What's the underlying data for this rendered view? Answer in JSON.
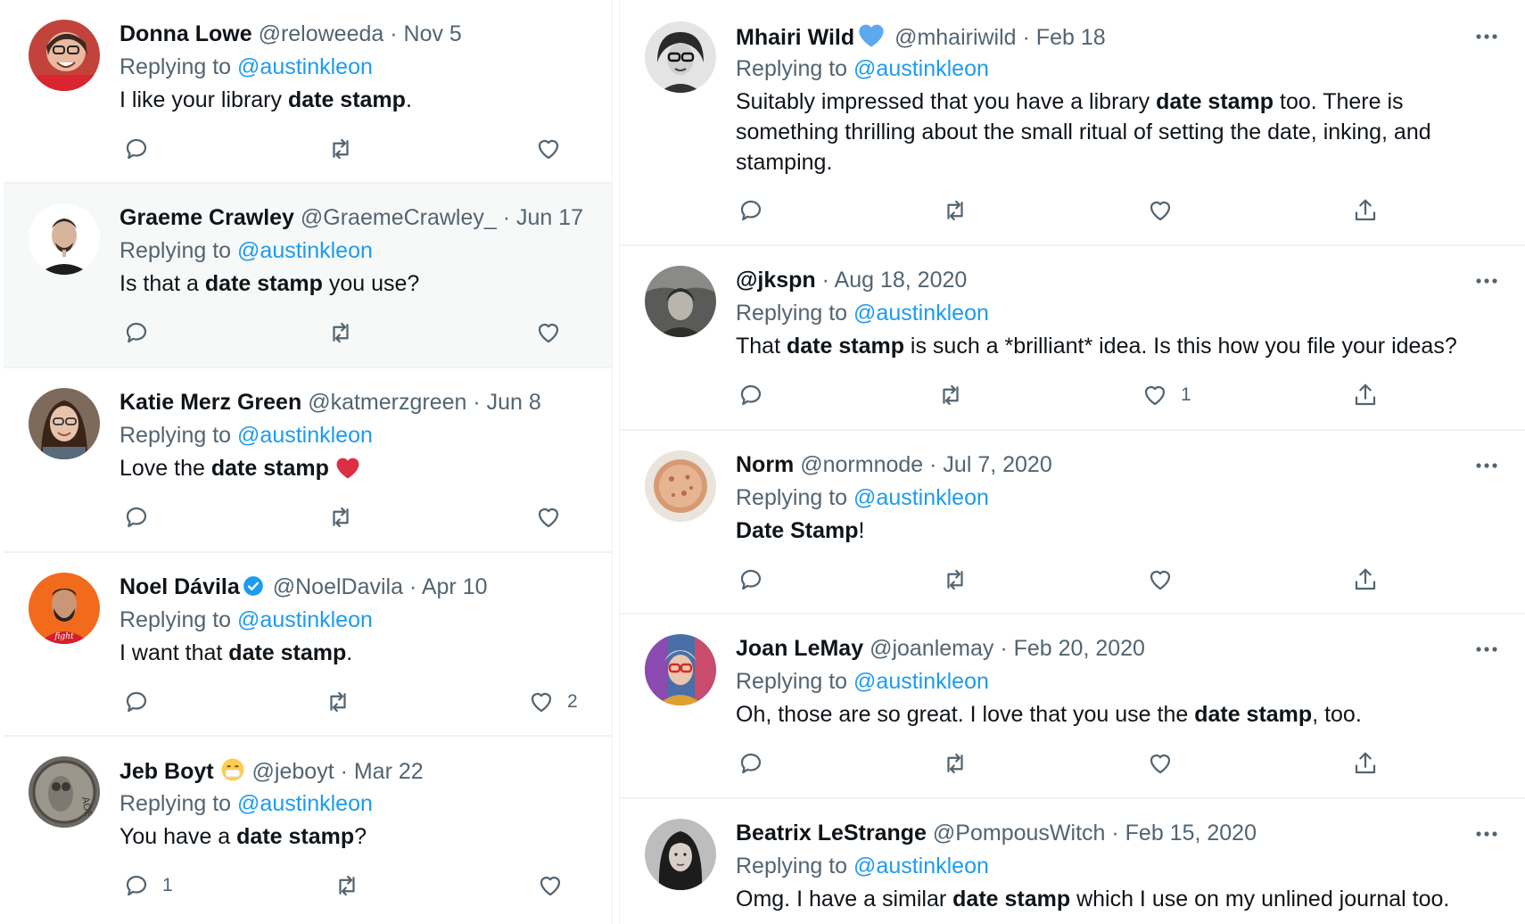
{
  "replying_prefix": "Replying to",
  "left": [
    {
      "name": "Donna Lowe",
      "handle": "@reloweeda",
      "date": "Nov 5",
      "mention": "@austinkleon",
      "pre": "I like your library ",
      "bold": "date stamp",
      "post": ".",
      "reply_count": "",
      "like_count": ""
    },
    {
      "name": "Graeme Crawley",
      "handle": "@GraemeCrawley_",
      "date": "Jun 17",
      "mention": "@austinkleon",
      "pre": "Is that a ",
      "bold": "date stamp",
      "post": " you use?",
      "reply_count": "",
      "like_count": ""
    },
    {
      "name": "Katie Merz Green",
      "handle": "@katmerzgreen",
      "date": "Jun 8",
      "mention": "@austinkleon",
      "pre": "Love the ",
      "bold": "date stamp",
      "post": "",
      "reply_count": "",
      "like_count": ""
    },
    {
      "name": "Noel Dávila",
      "handle": "@NoelDavila",
      "date": "Apr 10",
      "mention": "@austinkleon",
      "pre": "I want that ",
      "bold": "date stamp",
      "post": ".",
      "reply_count": "",
      "like_count": "2"
    },
    {
      "name": "Jeb Boyt",
      "handle": "@jeboyt",
      "date": "Mar 22",
      "mention": "@austinkleon",
      "pre": "You have a ",
      "bold": "date stamp",
      "post": "?",
      "reply_count": "1",
      "like_count": ""
    }
  ],
  "right": [
    {
      "name": "Mhairi Wild",
      "handle": "@mhairiwild",
      "date": "Feb 18",
      "mention": "@austinkleon",
      "pre": "Suitably impressed that you have a library ",
      "bold": "date stamp",
      "post": " too. There is something thrilling about the small ritual of setting the date, inking, and stamping.",
      "like_count": ""
    },
    {
      "name": "@jkspn",
      "handle": "",
      "date": "Aug 18, 2020",
      "mention": "@austinkleon",
      "pre": "That ",
      "bold": "date stamp",
      "post": " is such a *brilliant* idea. Is this how you file your ideas?",
      "like_count": "1"
    },
    {
      "name": "Norm",
      "handle": "@normnode",
      "date": "Jul 7, 2020",
      "mention": "@austinkleon",
      "pre": "",
      "bold": "Date Stamp",
      "post": "!",
      "like_count": ""
    },
    {
      "name": "Joan LeMay",
      "handle": "@joanlemay",
      "date": "Feb 20, 2020",
      "mention": "@austinkleon",
      "pre": "Oh, those are so great. I love that you use the ",
      "bold": "date stamp",
      "post": ", too.",
      "like_count": ""
    },
    {
      "name": "Beatrix LeStrange",
      "handle": "@PompousWitch",
      "date": "Feb 15, 2020",
      "mention": "@austinkleon",
      "pre": "Omg. I have a similar ",
      "bold": "date stamp",
      "post": " which I use on my unlined journal too.",
      "like_count": ""
    }
  ],
  "colors": {
    "accent": "#1d9bf0",
    "muted": "#536471",
    "text": "#0f1419",
    "heart": "#f91880",
    "divider": "#eff3f4"
  },
  "icons": [
    "reply-icon",
    "retweet-icon",
    "like-icon",
    "share-icon",
    "more-icon",
    "verified-icon",
    "heart-emoji-icon",
    "mask-emoji-icon"
  ]
}
